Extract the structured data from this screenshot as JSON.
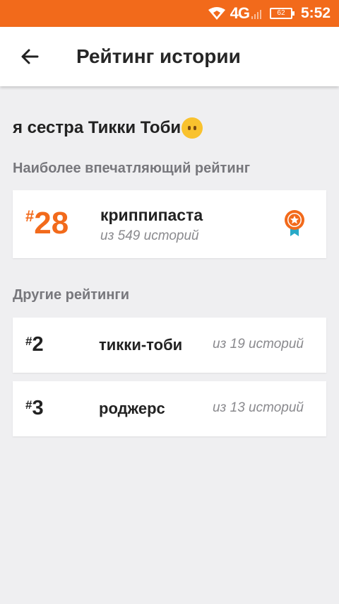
{
  "status_bar": {
    "network": "4G",
    "battery": "62",
    "time": "5:52",
    "bar_color": "#f26a1b"
  },
  "app_bar": {
    "back_icon": "arrow-left-icon",
    "title": "Рейтинг истории"
  },
  "story": {
    "title": "я сестра Тикки Тоби",
    "emoji_icon": "neutral-face-emoji"
  },
  "top_rating": {
    "section_label": "Наиболее впечатляющий рейтинг",
    "hash": "#",
    "rank": "28",
    "tag": "криппипаста",
    "subtitle": "из 549 историй",
    "badge_icon": "medal-icon",
    "accent_color": "#f26a1b"
  },
  "other_ratings": {
    "section_label": "Другие рейтинги",
    "items": [
      {
        "hash": "#",
        "rank": "2",
        "tag": "тикки-тоби",
        "subtitle": "из 19 историй"
      },
      {
        "hash": "#",
        "rank": "3",
        "tag": "роджерс",
        "subtitle": "из 13 историй"
      }
    ]
  }
}
